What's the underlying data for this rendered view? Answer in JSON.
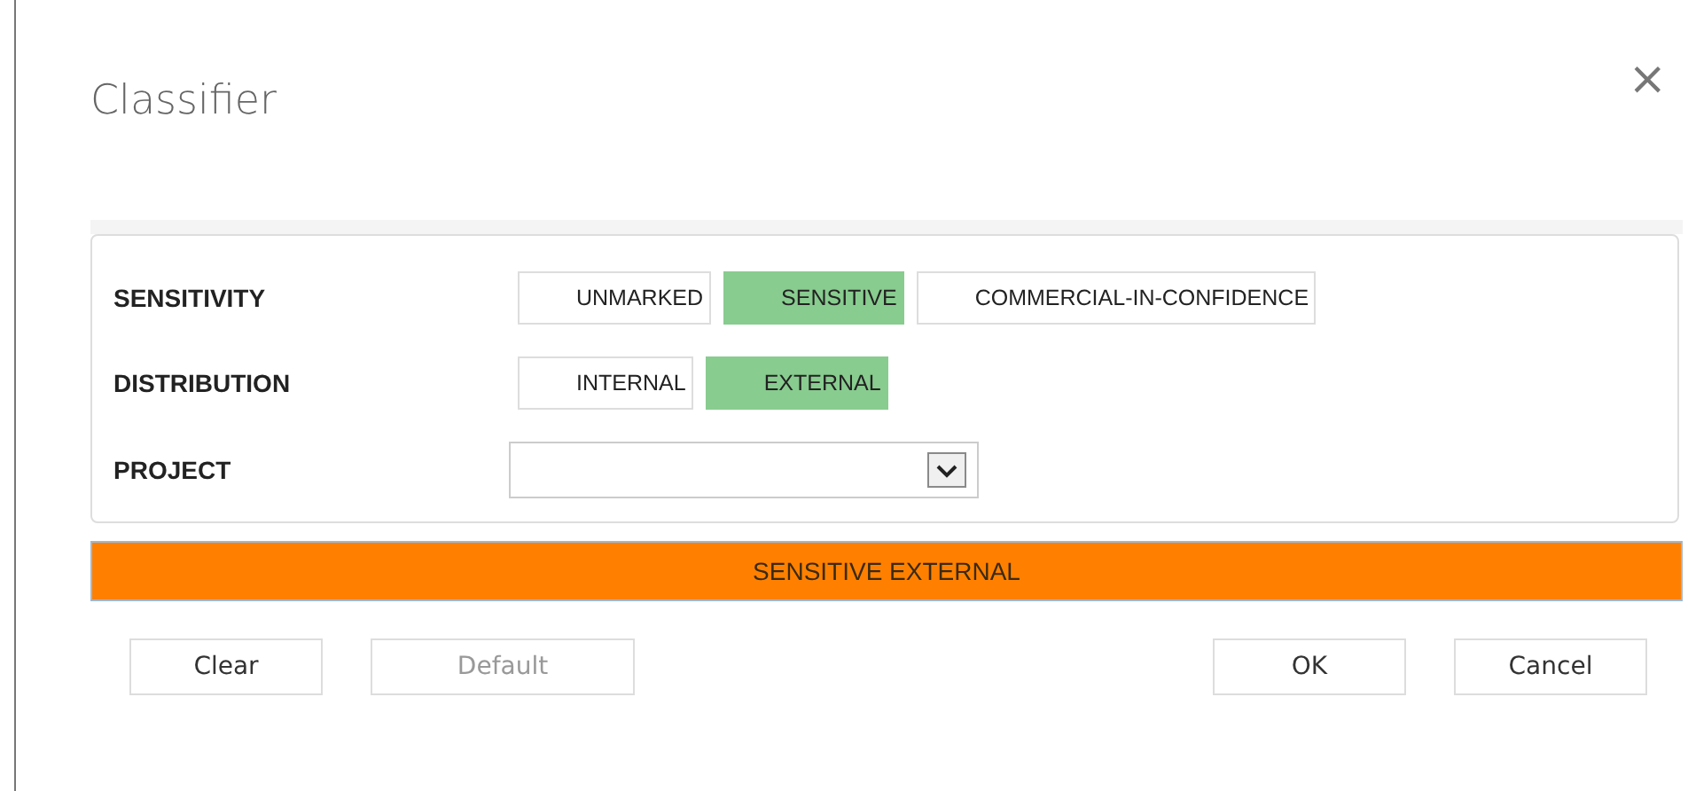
{
  "dialog": {
    "title": "Classifier",
    "close": "×"
  },
  "fields": [
    {
      "label": "SENSITIVITY",
      "kind": "options",
      "options": [
        {
          "label": "UNMARKED",
          "selected": false
        },
        {
          "label": "SENSITIVE",
          "selected": true
        },
        {
          "label": "COMMERCIAL-IN-CONFIDENCE",
          "selected": false
        }
      ]
    },
    {
      "label": "DISTRIBUTION",
      "kind": "options",
      "options": [
        {
          "label": "INTERNAL",
          "selected": false
        },
        {
          "label": "EXTERNAL",
          "selected": true
        }
      ]
    },
    {
      "label": "PROJECT",
      "kind": "dropdown"
    }
  ],
  "banner": "SENSITIVE EXTERNAL",
  "left_buttons": [
    {
      "label": "Clear",
      "disabled": false
    },
    {
      "label": "Default",
      "disabled": true
    }
  ],
  "right_buttons": [
    {
      "label": "OK",
      "disabled": false
    },
    {
      "label": "Cancel",
      "disabled": false
    }
  ]
}
